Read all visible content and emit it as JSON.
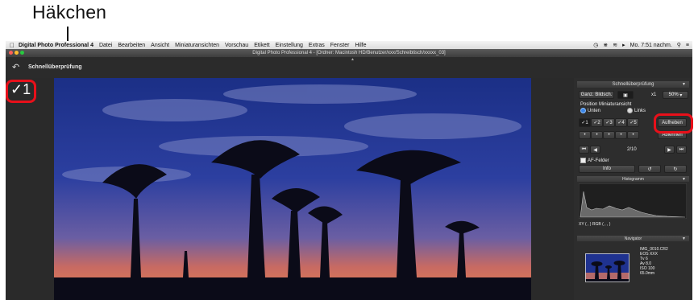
{
  "annotation": {
    "callout_label": "Häkchen"
  },
  "menubar": {
    "items": [
      "Digital Photo Professional 4",
      "Datei",
      "Bearbeiten",
      "Ansicht",
      "Miniaturansichten",
      "Vorschau",
      "Etikett",
      "Einstellung",
      "Extras",
      "Fenster",
      "Hilfe"
    ],
    "clock": "Mo. 7:51 nachm."
  },
  "window": {
    "title": "Digital Photo Professional 4 - [Ordner: Macintosh HD/Benutzer/xxx/Schreibtisch/xxxxx_03]"
  },
  "toolbar": {
    "title": "Schnellüberprüfung"
  },
  "viewer": {
    "check_label": "✓1"
  },
  "panel": {
    "quick_check": {
      "header": "Schnellüberprüfung",
      "full_screen_label": "Ganz. Bildsch.",
      "zoom_x1": "x1",
      "zoom_percent": "50%",
      "position_label": "Position Miniaturansicht",
      "option_bottom": "Unten",
      "option_left": "Links",
      "check_marks": [
        "✓1",
        "✓2",
        "✓3",
        "✓4",
        "✓5"
      ],
      "clear_button": "Aufheben",
      "unassign_button": "Ablehnen",
      "counter": "2/10",
      "af_points_label": "AF-Felder",
      "info_button": "Info"
    },
    "histogram": {
      "header": "Histogramm",
      "readout": "XY (      ,       )  RGB (      ,       ,       )"
    },
    "navigator": {
      "header": "Navigator",
      "file_info": [
        "IMG_0010.CR2",
        "EOS XXX",
        "Tv 6",
        "Av 8.0",
        "ISO 100",
        "65.0mm"
      ]
    }
  },
  "colors": {
    "highlight": "#e8101a",
    "panel_bg": "#2d2d2d",
    "accent": "#3b86e8"
  }
}
